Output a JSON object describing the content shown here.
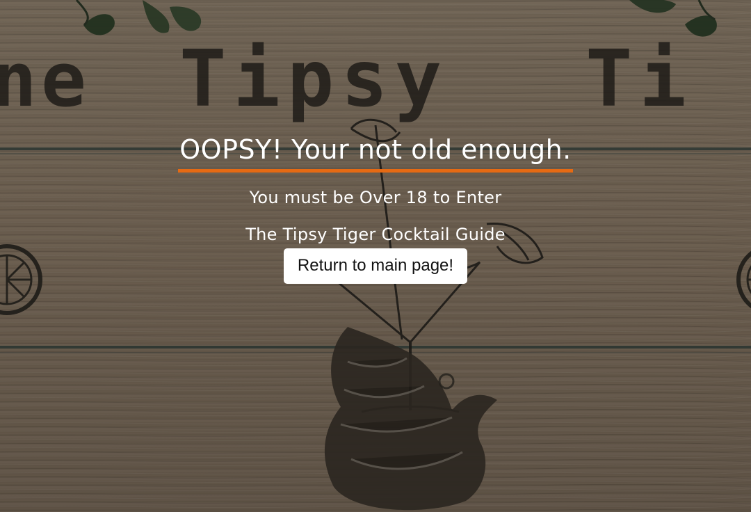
{
  "background": {
    "sign_text_left": "ne",
    "sign_text_center": "Tipsy",
    "sign_text_right": "Ti"
  },
  "message": {
    "title": "OOPSY! Your not old enough.",
    "subtitle": "You must be Over 18 to Enter",
    "site_name": "The Tipsy Tiger Cocktail Guide"
  },
  "actions": {
    "return_button": "Return to main page!"
  },
  "colors": {
    "accent_underline": "#e66a13",
    "text": "#ffffff",
    "button_bg": "#ffffff"
  }
}
